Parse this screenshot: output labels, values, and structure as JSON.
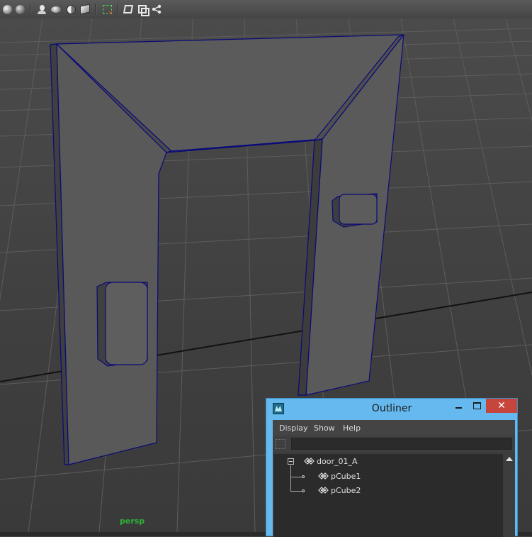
{
  "toolbar": {
    "icons": [
      "smooth-shade-sphere-icon",
      "wireframe-sphere-icon",
      "lighting-bust-icon",
      "textured-disc-icon",
      "half-shade-sphere-icon",
      "cubes-icon",
      "select-camera-icon",
      "isolate-box-icon",
      "frames-icon",
      "share-icon"
    ]
  },
  "viewport": {
    "camera_label": "persp",
    "colors": {
      "mesh": "#5c5c5c",
      "wire_selected": "#0a0a7a",
      "grid": "#5e5e5e",
      "axis": "#111111"
    }
  },
  "outliner": {
    "title": "Outliner",
    "close_glyph": "✕",
    "menu": [
      "Display",
      "Show",
      "Help"
    ],
    "search_value": "",
    "tree": [
      {
        "label": "door_01_A",
        "type": "group",
        "expanded": true
      },
      {
        "label": "pCube1",
        "type": "mesh"
      },
      {
        "label": "pCube2",
        "type": "mesh"
      }
    ],
    "colors": {
      "titlebar": "#66b9ee",
      "close": "#c7463c"
    }
  }
}
